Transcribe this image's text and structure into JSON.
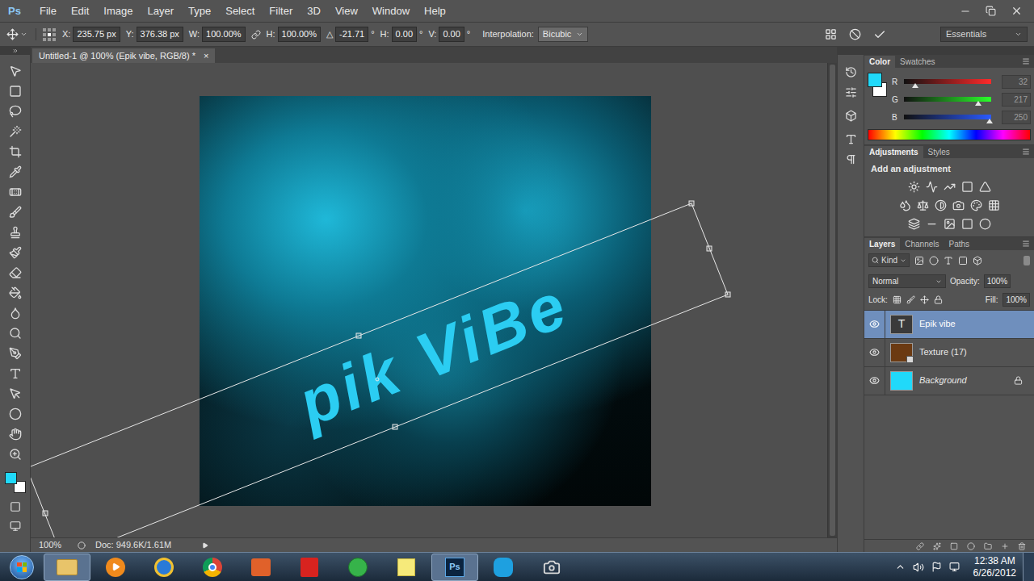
{
  "app": {
    "logo": "Ps"
  },
  "menu": [
    "File",
    "Edit",
    "Image",
    "Layer",
    "Type",
    "Select",
    "Filter",
    "3D",
    "View",
    "Window",
    "Help"
  ],
  "options_bar": {
    "fields": [
      {
        "label": "X:",
        "value": "235.75 px"
      },
      {
        "label": "Y:",
        "value": "376.38 px"
      },
      {
        "label": "W:",
        "value": "100.00%"
      },
      {
        "label": "H:",
        "value": "100.00%"
      },
      {
        "label": "△",
        "value": "-21.71",
        "unit": "°"
      },
      {
        "label": "H:",
        "value": "0.00",
        "unit": "°"
      },
      {
        "label": "V:",
        "value": "0.00",
        "unit": "°"
      }
    ],
    "interpolation": {
      "label": "Interpolation:",
      "value": "Bicubic"
    },
    "workspace": "Essentials"
  },
  "document_tab": {
    "title": "Untitled-1 @ 100% (Epik vibe, RGB/8) *",
    "close": "×",
    "selected": true
  },
  "canvas": {
    "text": "pik ViBe"
  },
  "status_bar": {
    "zoom": "100%",
    "doc": "Doc: 949.6K/1.61M"
  },
  "colors": {
    "foreground": "#20d9fa",
    "background": "#ffffff"
  },
  "color_panel": {
    "tabs": [
      {
        "label": "Color",
        "selected": true
      },
      {
        "label": "Swatches",
        "selected": false
      }
    ],
    "channels": [
      {
        "name": "R",
        "value": "32",
        "level": 0.125,
        "color": "#ff2a2a"
      },
      {
        "name": "G",
        "value": "217",
        "level": 0.851,
        "color": "#2aff2a"
      },
      {
        "name": "B",
        "value": "250",
        "level": 0.98,
        "color": "#2a5aff"
      }
    ]
  },
  "adjustments_panel": {
    "tabs": [
      {
        "label": "Adjustments",
        "selected": true
      },
      {
        "label": "Styles",
        "selected": false
      }
    ],
    "hint": "Add an adjustment"
  },
  "layers_panel": {
    "tabs": [
      {
        "label": "Layers",
        "selected": true
      },
      {
        "label": "Channels",
        "selected": false
      },
      {
        "label": "Paths",
        "selected": false
      }
    ],
    "filter": "Kind",
    "blend_mode": "Normal",
    "opacity": {
      "label": "Opacity:",
      "value": "100%"
    },
    "lock_label": "Lock:",
    "fill": {
      "label": "Fill:",
      "value": "100%"
    },
    "layers": [
      {
        "name": "Epik vibe",
        "kind": "text",
        "glyph": "T",
        "selected": true,
        "visible": true,
        "locked": false,
        "color": "#3a3a3a"
      },
      {
        "name": "Texture (17)",
        "kind": "smart",
        "selected": false,
        "visible": true,
        "locked": false,
        "color": "#6b3a12"
      },
      {
        "name": "Background",
        "kind": "background",
        "selected": false,
        "visible": true,
        "locked": true,
        "color": "#20d9fa"
      }
    ]
  },
  "taskbar": {
    "apps": [
      {
        "active": true
      },
      {
        "active": false
      },
      {
        "active": false
      },
      {
        "active": false
      },
      {
        "active": false
      },
      {
        "active": false
      },
      {
        "active": false
      },
      {
        "active": false
      },
      {
        "active": true
      },
      {
        "active": false
      },
      {
        "active": false
      }
    ],
    "time": "12:38 AM",
    "date": "6/26/2012"
  }
}
